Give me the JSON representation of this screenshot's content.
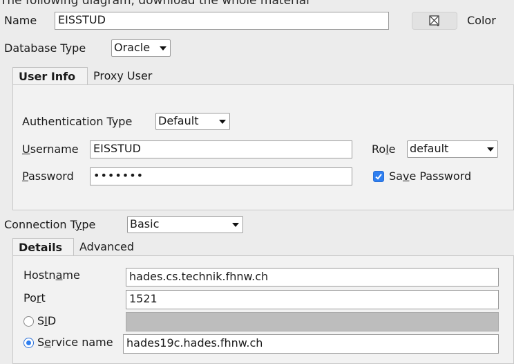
{
  "top_cut_text": "The following diagram, download the whole material",
  "connection": {
    "name_label": "Name",
    "name_value": "EISSTUD",
    "color_label": "Color",
    "db_type_label": "Database Type",
    "db_type_value": "Oracle"
  },
  "tabs_top": {
    "user_info": "User Info",
    "proxy_user": "Proxy User"
  },
  "user_info": {
    "auth_type_label": "Authentication Type",
    "auth_type_value": "Default",
    "username_label_u": "U",
    "username_label_rest": "sername",
    "username_value": "EISSTUD",
    "password_label_u": "P",
    "password_label_rest": "assword",
    "password_value": "•••••••",
    "role_label_a": "Ro",
    "role_label_u": "l",
    "role_label_b": "e",
    "role_value": "default",
    "save_pw_a": "Sa",
    "save_pw_u": "v",
    "save_pw_b": "e Password"
  },
  "connection_type": {
    "label_a": "Connection T",
    "label_u": "y",
    "label_b": "pe",
    "value": "Basic"
  },
  "tabs_bottom": {
    "details": "Details",
    "advanced": "Advanced"
  },
  "details": {
    "hostname_a": "Hostn",
    "hostname_u": "a",
    "hostname_b": "me",
    "hostname_value": "hades.cs.technik.fhnw.ch",
    "port_a": "Po",
    "port_u": "r",
    "port_b": "t",
    "port_value": "1521",
    "sid_a": "S",
    "sid_u": "I",
    "sid_b": "D",
    "sid_value": "",
    "service_a": "S",
    "service_u": "e",
    "service_b": "rvice name",
    "service_value": "hades19c.hades.fhnw.ch"
  }
}
